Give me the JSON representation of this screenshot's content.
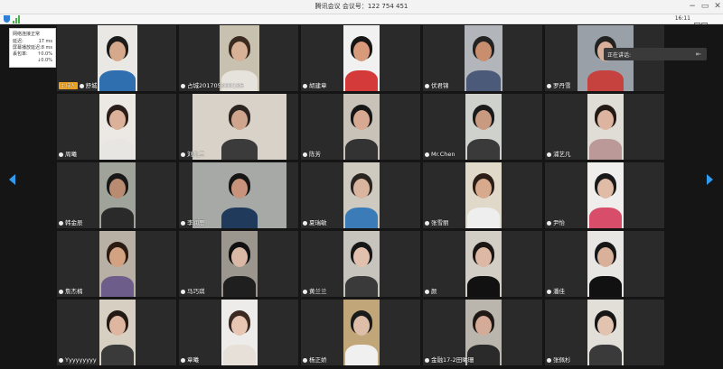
{
  "window": {
    "title": "腾讯会议 会议号：122 754 451",
    "minimize": "−",
    "maximize": "▭",
    "close": "✕"
  },
  "toolbar": {
    "timer": "16:11",
    "accent_color": "#2e9cf0"
  },
  "network": {
    "title": "网络连接正常",
    "rows": [
      {
        "label": "延迟:",
        "value": "17 ms"
      },
      {
        "label": "屏幕播放延迟:",
        "value": "8 ms"
      },
      {
        "label": "丢包率:",
        "value": "↑0.0%"
      },
      {
        "label": "",
        "value": "↓0.0%"
      }
    ]
  },
  "speaking": {
    "label": "正在讲话:",
    "close_icon": "⇤"
  },
  "host_badge": "主持人",
  "participants": [
    {
      "name": "舒城",
      "host": true
    },
    {
      "name": "占城201705000186"
    },
    {
      "name": "胡建章"
    },
    {
      "name": "伏君锦"
    },
    {
      "name": "罗丹雪"
    },
    {
      "name": "周曦"
    },
    {
      "name": "刘凡三"
    },
    {
      "name": "陈芳"
    },
    {
      "name": "Mr.Chen"
    },
    {
      "name": "浦艺凡"
    },
    {
      "name": "韩金辰"
    },
    {
      "name": "李润思"
    },
    {
      "name": "夏瑞敏"
    },
    {
      "name": "张雪丽"
    },
    {
      "name": "尹怡"
    },
    {
      "name": "詹杰楠"
    },
    {
      "name": "马巧琪"
    },
    {
      "name": "黄兰兰"
    },
    {
      "name": "颜"
    },
    {
      "name": "潘佳"
    },
    {
      "name": "Yyyyyyyyy"
    },
    {
      "name": "章曦"
    },
    {
      "name": "杨正娇"
    },
    {
      "name": "金融17-2田曦珊"
    },
    {
      "name": "张佩杉"
    }
  ]
}
